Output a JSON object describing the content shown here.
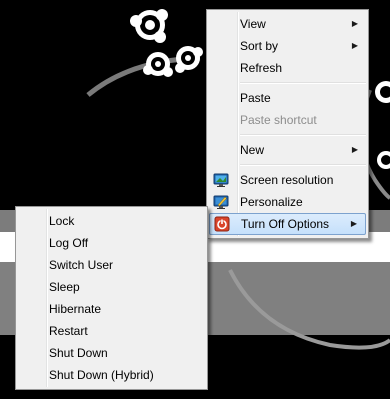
{
  "context_menu": {
    "items": [
      {
        "label": "View",
        "has_submenu": true
      },
      {
        "label": "Sort by",
        "has_submenu": true
      },
      {
        "label": "Refresh"
      },
      {
        "label": "Paste"
      },
      {
        "label": "Paste shortcut",
        "disabled": true
      },
      {
        "label": "New",
        "has_submenu": true
      },
      {
        "label": "Screen resolution",
        "icon": "screen-resolution-icon"
      },
      {
        "label": "Personalize",
        "icon": "personalize-icon"
      },
      {
        "label": "Turn Off Options",
        "icon": "power-icon",
        "has_submenu": true,
        "highlighted": true
      }
    ],
    "submenu_arrow": "▶"
  },
  "submenu": {
    "items": [
      {
        "label": "Lock"
      },
      {
        "label": "Log Off"
      },
      {
        "label": "Switch User"
      },
      {
        "label": "Sleep"
      },
      {
        "label": "Hibernate"
      },
      {
        "label": "Restart"
      },
      {
        "label": "Shut Down"
      },
      {
        "label": "Shut Down (Hybrid)"
      }
    ]
  },
  "colors": {
    "menu_background": "#f0f0f0",
    "highlight": "#c5e0fb",
    "desktop_dark": "#000000",
    "desktop_band": "#808080"
  }
}
